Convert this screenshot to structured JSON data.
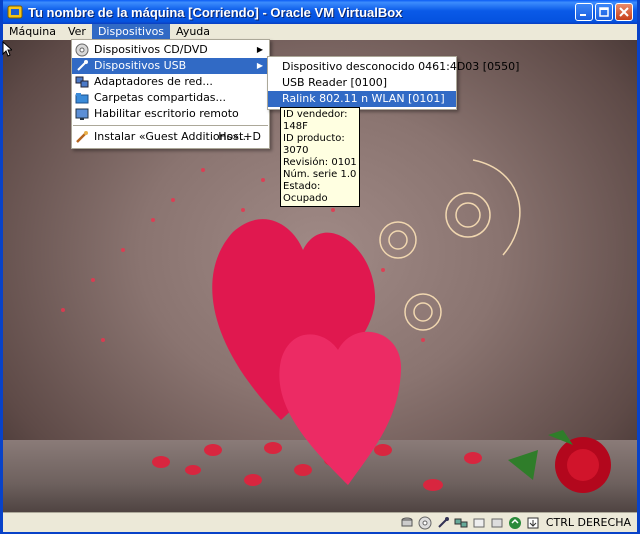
{
  "window": {
    "title": "Tu nombre de la máquina [Corriendo] - Oracle VM VirtualBox"
  },
  "menubar": {
    "items": [
      "Máquina",
      "Ver",
      "Dispositivos",
      "Ayuda"
    ]
  },
  "devices_menu": {
    "items": [
      {
        "label": "Dispositivos CD/DVD",
        "icon": "cd-icon"
      },
      {
        "label": "Dispositivos USB",
        "icon": "usb-icon"
      },
      {
        "label": "Adaptadores de red...",
        "icon": "network-icon"
      },
      {
        "label": "Carpetas compartidas...",
        "icon": "folder-icon"
      },
      {
        "label": "Habilitar escritorio remoto",
        "icon": "remote-desktop-icon"
      },
      {
        "label": "Instalar «Guest Additions»...",
        "icon": "install-icon",
        "shortcut": "Host+D"
      }
    ]
  },
  "usb_menu": {
    "items": [
      "Dispositivo desconocido 0461:4D03 [0550]",
      "USB Reader [0100]",
      "Ralink 802.11 n WLAN [0101]"
    ]
  },
  "tooltip": {
    "lines": [
      "ID vendedor: 148F",
      "ID producto: 3070",
      "Revisión: 0101",
      "Núm. serie 1.0",
      "Estado: Ocupado"
    ]
  },
  "statusbar": {
    "host_key": "CTRL DERECHA"
  }
}
